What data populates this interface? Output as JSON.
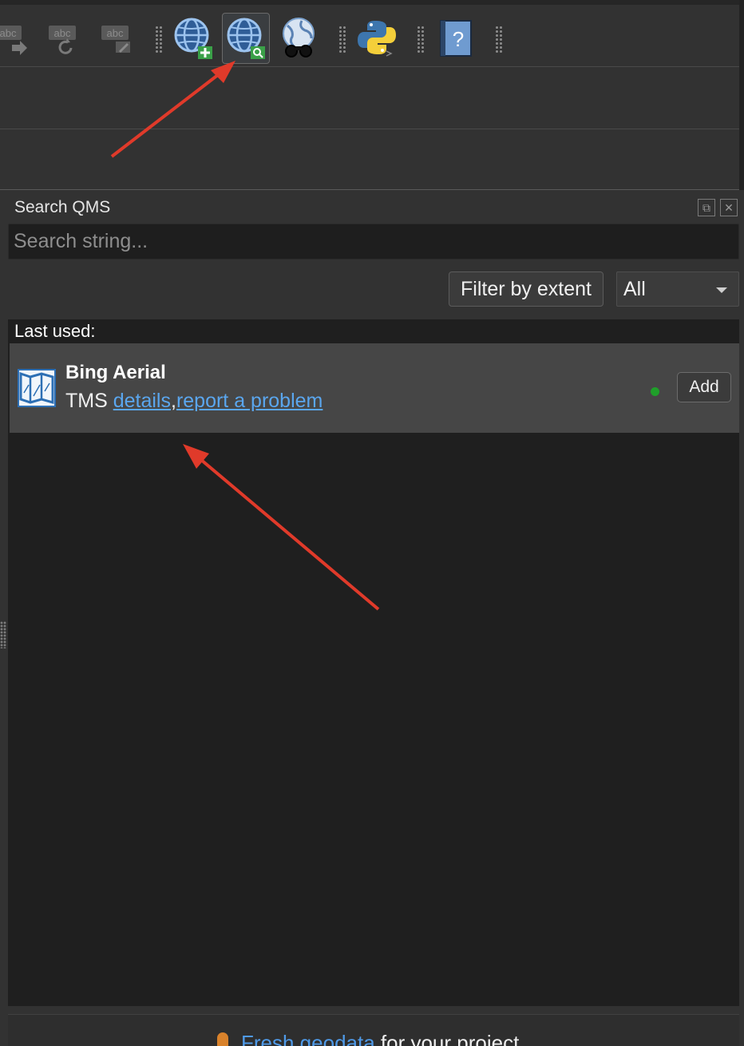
{
  "toolbar": {
    "buttons": [
      {
        "name": "label-move-button",
        "text": "abc"
      },
      {
        "name": "label-rotate-button",
        "text": "abc"
      },
      {
        "name": "label-edit-button",
        "text": "abc"
      },
      {
        "name": "add-web-service-button"
      },
      {
        "name": "search-qms-button",
        "active": true
      },
      {
        "name": "world-binoculars-button"
      },
      {
        "name": "python-console-button"
      },
      {
        "name": "help-button",
        "text": "?"
      }
    ]
  },
  "panel": {
    "title": "Search QMS",
    "search_placeholder": "Search string...",
    "filter_button": "Filter by extent",
    "filter_select_value": "All",
    "last_used_label": "Last used:",
    "result": {
      "name": "Bing Aerial",
      "type": "TMS",
      "details_link": "details",
      "separator": ",",
      "report_link": "report a problem",
      "add_button": "Add",
      "status_color": "#1f9f2a"
    },
    "footer": {
      "link": "Fresh geodata",
      "text": " for your project"
    }
  },
  "colors": {
    "accent_link": "#5aa6ee",
    "arrow": "#e03a2a"
  }
}
